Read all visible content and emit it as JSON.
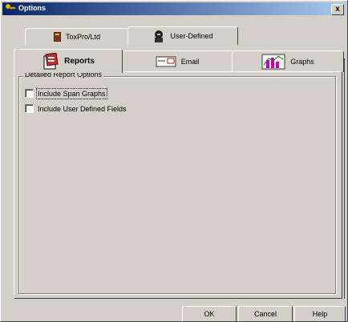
{
  "window": {
    "title": "Options",
    "close_label": "x"
  },
  "tabs": {
    "row_back": [
      {
        "label": "ToxPro/Ltd",
        "icon": "book-icon"
      },
      {
        "label": "User-Defined",
        "icon": "person-icon"
      }
    ],
    "row_front": [
      {
        "label": "Reports",
        "icon": "report-icon",
        "selected": true
      },
      {
        "label": "Email",
        "icon": "email-icon"
      },
      {
        "label": "Graphs",
        "icon": "graph-icon"
      }
    ]
  },
  "group": {
    "label": "Detailed Report Options",
    "options": [
      {
        "label": "Include Span Graphs",
        "checked": false
      },
      {
        "label": "Include User Defined Fields",
        "checked": false
      }
    ]
  },
  "buttons": {
    "ok": "OK",
    "cancel": "Cancel",
    "help": "Help"
  },
  "colors": {
    "titlebar_start": "#0a246a",
    "titlebar_end": "#a6caf0",
    "face": "#d4d0c8"
  }
}
